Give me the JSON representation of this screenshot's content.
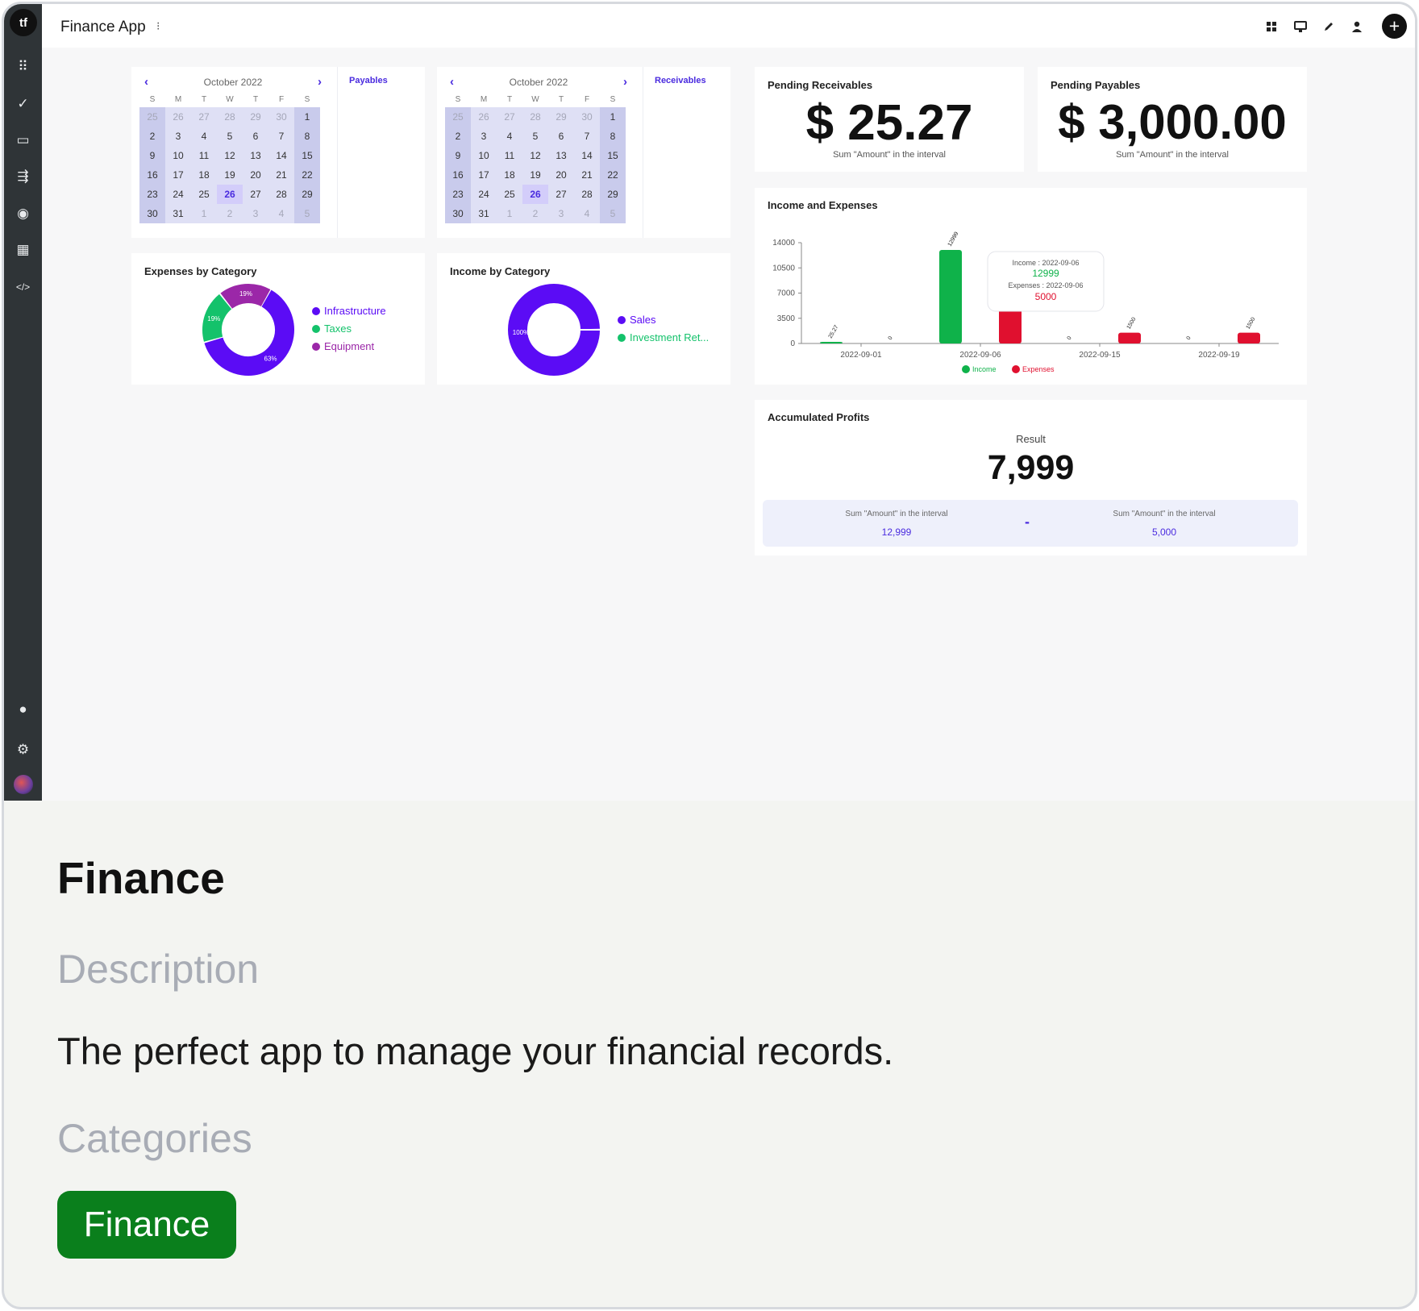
{
  "app": {
    "title": "Finance App",
    "title_menu": "⁝"
  },
  "sidebar": {
    "logo": "tf",
    "items": [
      {
        "icon": "apps-grid-icon",
        "glyph": "⠿"
      },
      {
        "icon": "check-circle-icon",
        "glyph": "✓"
      },
      {
        "icon": "chat-icon",
        "glyph": "▭"
      },
      {
        "icon": "workflow-icon",
        "glyph": "⇶"
      },
      {
        "icon": "database-icon",
        "glyph": "◉"
      },
      {
        "icon": "layout-icon",
        "glyph": "▦"
      },
      {
        "icon": "code-icon",
        "glyph": "</>"
      }
    ],
    "bottom": [
      {
        "icon": "user-icon",
        "glyph": "●"
      },
      {
        "icon": "settings-icon",
        "glyph": "⚙"
      }
    ]
  },
  "toolbar": {
    "icons": [
      "grid-icon",
      "monitor-icon",
      "pencil-icon",
      "user-icon",
      "add-icon"
    ],
    "plus": "+"
  },
  "calendars": [
    {
      "month": "October 2022",
      "link": "Payables",
      "dow": [
        "S",
        "M",
        "T",
        "W",
        "T",
        "F",
        "S"
      ],
      "days": [
        "25",
        "26",
        "27",
        "28",
        "29",
        "30",
        "1",
        "2",
        "3",
        "4",
        "5",
        "6",
        "7",
        "8",
        "9",
        "10",
        "11",
        "12",
        "13",
        "14",
        "15",
        "16",
        "17",
        "18",
        "19",
        "20",
        "21",
        "22",
        "23",
        "24",
        "25",
        "26",
        "27",
        "28",
        "29",
        "30",
        "31",
        "1",
        "2",
        "3",
        "4",
        "5"
      ],
      "today": "26"
    },
    {
      "month": "October 2022",
      "link": "Receivables",
      "dow": [
        "S",
        "M",
        "T",
        "W",
        "T",
        "F",
        "S"
      ],
      "days": [
        "25",
        "26",
        "27",
        "28",
        "29",
        "30",
        "1",
        "2",
        "3",
        "4",
        "5",
        "6",
        "7",
        "8",
        "9",
        "10",
        "11",
        "12",
        "13",
        "14",
        "15",
        "16",
        "17",
        "18",
        "19",
        "20",
        "21",
        "22",
        "23",
        "24",
        "25",
        "26",
        "27",
        "28",
        "29",
        "30",
        "31",
        "1",
        "2",
        "3",
        "4",
        "5"
      ],
      "today": "26"
    }
  ],
  "kpis": {
    "receivables": {
      "title": "Pending Receivables",
      "value": "$ 25.27",
      "sub": "Sum \"Amount\" in the interval"
    },
    "payables": {
      "title": "Pending Payables",
      "value": "$ 3,000.00",
      "sub": "Sum \"Amount\" in the interval"
    }
  },
  "expenses_by_category": {
    "title": "Expenses by Category",
    "legend": [
      {
        "label": "Infrastructure",
        "color": "#5b0cf5"
      },
      {
        "label": "Taxes",
        "color": "#14c26b"
      },
      {
        "label": "Equipment",
        "color": "#9b27a8"
      }
    ],
    "slices": [
      {
        "label": "Infrastructure",
        "value": 63,
        "text": "63%"
      },
      {
        "label": "Taxes",
        "value": 19,
        "text": "19%"
      },
      {
        "label": "Equipment",
        "value": 19,
        "text": "19%"
      }
    ]
  },
  "income_by_category": {
    "title": "Income by Category",
    "legend": [
      {
        "label": "Sales",
        "color": "#5b0cf5"
      },
      {
        "label": "Investment Ret...",
        "color": "#14c26b"
      }
    ],
    "slices": [
      {
        "label": "Sales",
        "value": 100,
        "text": "100%"
      },
      {
        "label": "Investment Ret...",
        "value": 0,
        "text": ""
      }
    ]
  },
  "chart_data": {
    "type": "bar",
    "title": "Income and Expenses",
    "categories": [
      "2022-09-01",
      "2022-09-06",
      "2022-09-15",
      "2022-09-19"
    ],
    "series": [
      {
        "name": "Income",
        "color": "#0fb24a",
        "values": [
          25.27,
          12999,
          0,
          0
        ],
        "labels": [
          "25.27",
          "12999",
          "0",
          "0"
        ]
      },
      {
        "name": "Expenses",
        "color": "#e0102f",
        "values": [
          0,
          5000,
          1500,
          1500
        ],
        "labels": [
          "0",
          "5000",
          "1500",
          "1500"
        ]
      }
    ],
    "ylim": [
      0,
      14000
    ],
    "yticks": [
      "0",
      "3500",
      "7000",
      "10500",
      "14000"
    ],
    "tooltip": {
      "line1": "Income : 2022-09-06",
      "value1": "12999",
      "line2": "Expenses : 2022-09-06",
      "value2": "5000"
    },
    "legend_position": "bottom"
  },
  "profits": {
    "title": "Accumulated Profits",
    "label": "Result",
    "value": "7,999",
    "left_caption": "Sum \"Amount\" in the interval",
    "left_value": "12,999",
    "operator": "-",
    "right_caption": "Sum \"Amount\" in the interval",
    "right_value": "5,000"
  },
  "info": {
    "title": "Finance",
    "description_heading": "Description",
    "description": "The perfect app to manage your financial records.",
    "categories_heading": "Categories",
    "tag": "Finance"
  }
}
